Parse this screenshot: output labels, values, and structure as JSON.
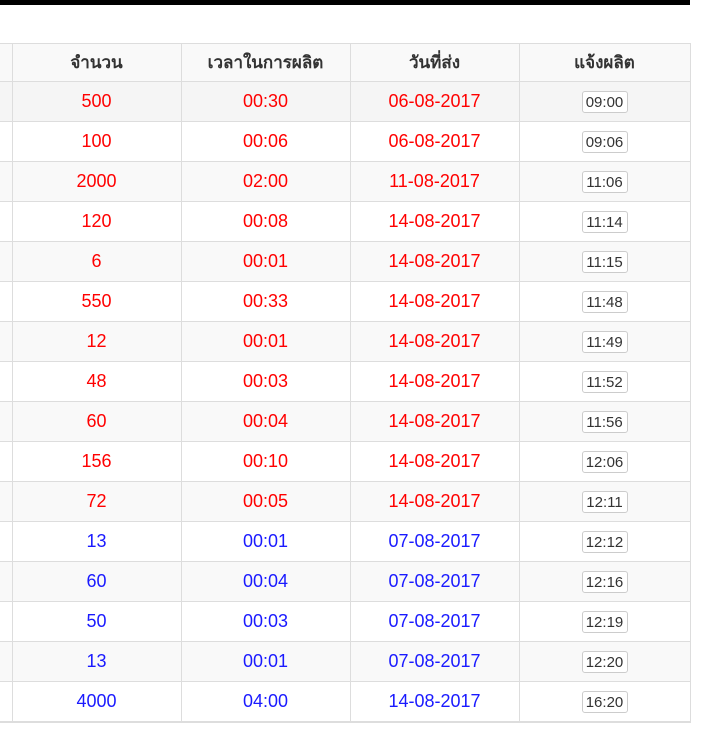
{
  "colors": {
    "red_text": "#ff0000",
    "blue_text": "#1a1aff"
  },
  "table": {
    "headers": [
      "จำนวน",
      "เวลาในการผลิต",
      "วันที่ส่ง",
      "แจ้งผลิต"
    ],
    "rows": [
      {
        "qty": "500",
        "duration": "00:30",
        "date": "06-08-2017",
        "notify": "09:00",
        "color": "red"
      },
      {
        "qty": "100",
        "duration": "00:06",
        "date": "06-08-2017",
        "notify": "09:06",
        "color": "red"
      },
      {
        "qty": "2000",
        "duration": "02:00",
        "date": "11-08-2017",
        "notify": "11:06",
        "color": "red"
      },
      {
        "qty": "120",
        "duration": "00:08",
        "date": "14-08-2017",
        "notify": "11:14",
        "color": "red"
      },
      {
        "qty": "6",
        "duration": "00:01",
        "date": "14-08-2017",
        "notify": "11:15",
        "color": "red"
      },
      {
        "qty": "550",
        "duration": "00:33",
        "date": "14-08-2017",
        "notify": "11:48",
        "color": "red"
      },
      {
        "qty": "12",
        "duration": "00:01",
        "date": "14-08-2017",
        "notify": "11:49",
        "color": "red"
      },
      {
        "qty": "48",
        "duration": "00:03",
        "date": "14-08-2017",
        "notify": "11:52",
        "color": "red"
      },
      {
        "qty": "60",
        "duration": "00:04",
        "date": "14-08-2017",
        "notify": "11:56",
        "color": "red"
      },
      {
        "qty": "156",
        "duration": "00:10",
        "date": "14-08-2017",
        "notify": "12:06",
        "color": "red"
      },
      {
        "qty": "72",
        "duration": "00:05",
        "date": "14-08-2017",
        "notify": "12:11",
        "color": "red"
      },
      {
        "qty": "13",
        "duration": "00:01",
        "date": "07-08-2017",
        "notify": "12:12",
        "color": "blue"
      },
      {
        "qty": "60",
        "duration": "00:04",
        "date": "07-08-2017",
        "notify": "12:16",
        "color": "blue"
      },
      {
        "qty": "50",
        "duration": "00:03",
        "date": "07-08-2017",
        "notify": "12:19",
        "color": "blue"
      },
      {
        "qty": "13",
        "duration": "00:01",
        "date": "07-08-2017",
        "notify": "12:20",
        "color": "blue"
      },
      {
        "qty": "4000",
        "duration": "04:00",
        "date": "14-08-2017",
        "notify": "16:20",
        "color": "blue"
      }
    ]
  }
}
